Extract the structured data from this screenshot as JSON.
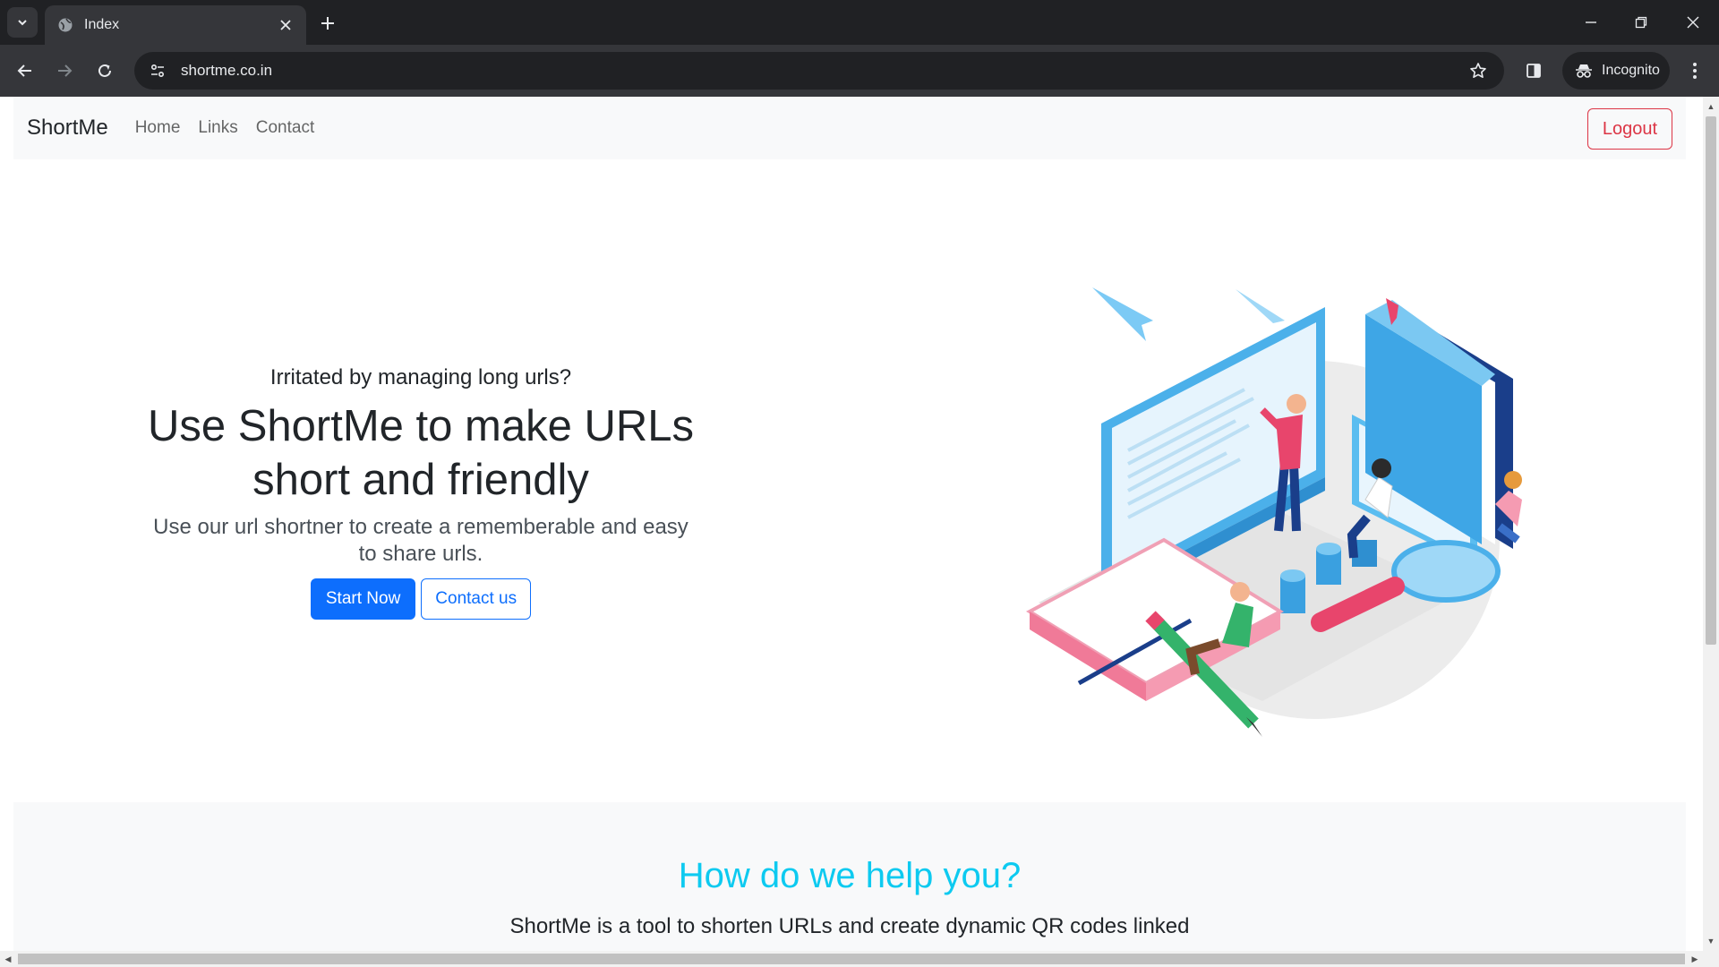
{
  "browser": {
    "tab_title": "Index",
    "url": "shortme.co.in",
    "incognito_label": "Incognito"
  },
  "navbar": {
    "brand": "ShortMe",
    "links": [
      "Home",
      "Links",
      "Contact"
    ],
    "logout_label": "Logout"
  },
  "hero": {
    "kicker": "Irritated by managing long urls?",
    "title_line1": "Use ShortMe to make URLs",
    "title_line2": "short and friendly",
    "subtitle_line1": "Use our url shortner to create a rememberable and easy",
    "subtitle_line2": "to share urls.",
    "primary_button": "Start Now",
    "secondary_button": "Contact us"
  },
  "help": {
    "title": "How do we help you?",
    "text": "ShortMe is a tool to shorten URLs and create dynamic QR codes linked"
  },
  "colors": {
    "primary": "#0d6efd",
    "danger": "#dc3545",
    "info": "#0dcaf0",
    "navbar_bg": "#f8f9fa"
  },
  "icons": [
    "tab-search-icon",
    "globe-icon",
    "close-icon",
    "plus-icon",
    "minimize-icon",
    "restore-icon",
    "back-icon",
    "forward-icon",
    "reload-icon",
    "site-info-icon",
    "star-icon",
    "side-panel-icon",
    "incognito-icon",
    "menu-icon"
  ]
}
